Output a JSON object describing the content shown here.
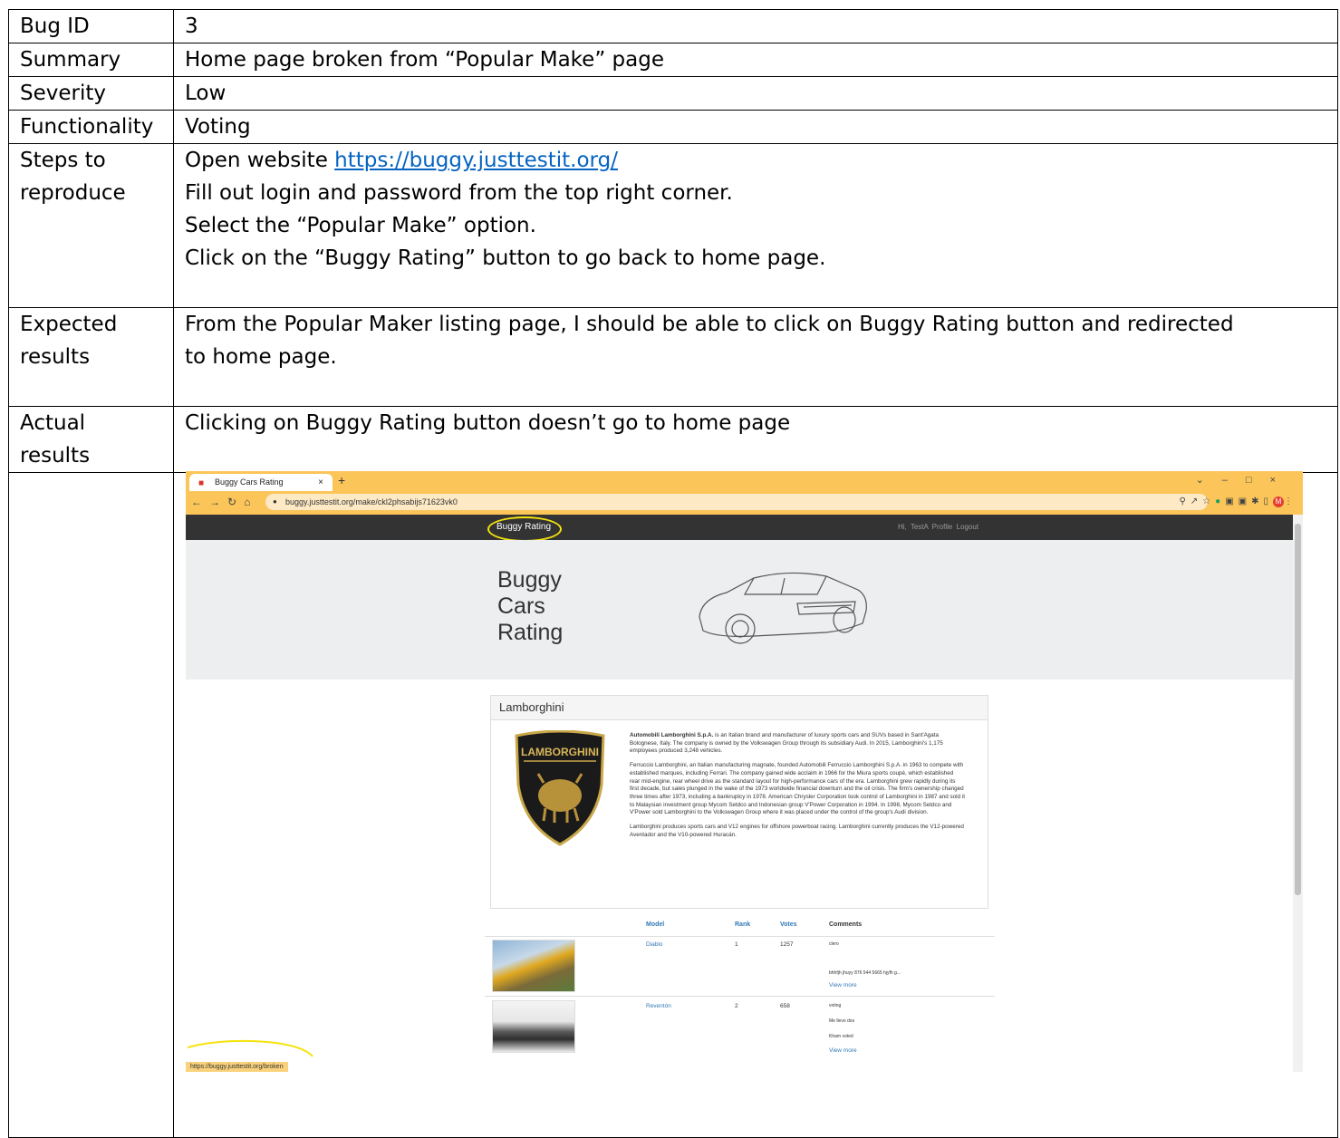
{
  "report": {
    "bug_id_label": "Bug ID",
    "bug_id": "3",
    "summary_label": "Summary",
    "summary": "Home page broken from “Popular Make” page",
    "severity_label": "Severity",
    "severity": "Low",
    "functionality_label": "Functionality",
    "functionality": "Voting",
    "steps_label_1": "Steps to",
    "steps_label_2": "reproduce",
    "steps_open_prefix": "Open website ",
    "steps_url": "https://buggy.justtestit.org/",
    "steps": [
      "Fill out login and password from the top right corner.",
      "Select the “Popular Make” option.",
      "Click on the “Buggy Rating” button to go back to home page."
    ],
    "expected_label_1": "Expected",
    "expected_label_2": "results",
    "expected_line_1": "From the Popular Maker listing page, I should be able to click on Buggy Rating button and redirected",
    "expected_line_2": "to home page.",
    "actual_label_1": "Actual",
    "actual_label_2": "results",
    "actual": "Clicking on Buggy Rating button doesn’t go to home page"
  },
  "browser": {
    "tab_title": "Buggy Cars Rating",
    "tab_close": "×",
    "new_tab": "+",
    "url": "buggy.justtestit.org/make/ckl2phsabijs71623vk0",
    "status_url": "https://buggy.justtestit.org/broken",
    "colors": {
      "chrome": "#fbc55a",
      "highlight": "#f5e30d"
    }
  },
  "site": {
    "brand": "Buggy Rating",
    "user_greeting": "Hi, TestA",
    "profile": "Profile",
    "logout": "Logout",
    "hero_title_1": "Buggy",
    "hero_title_2": "Cars",
    "hero_title_3": "Rating",
    "make_name": "Lamborghini",
    "logo_text": "LAMBORGHINI",
    "desc_lead": "Automobili Lamborghini S.p.A.",
    "desc_p1": " is an Italian brand and manufacturer of luxury sports cars and SUVs based in Sant'Agata Bolognese, Italy. The company is owned by the Volkswagen Group through its subsidiary Audi. In 2015, Lamborghini's 1,175 employees produced 3,248 vehicles.",
    "desc_p2": "Ferruccio Lamborghini, an Italian manufacturing magnate, founded Automobili Ferruccio Lamborghini S.p.A. in 1963 to compete with established marques, including Ferrari. The company gained wide acclaim in 1966 for the Miura sports coupé, which established rear mid-engine, rear wheel drive as the standard layout for high-performance cars of the era. Lamborghini grew rapidly during its first decade, but sales plunged in the wake of the 1973 worldwide financial downturn and the oil crisis. The firm's ownership changed three times after 1973, including a bankruptcy in 1978. American Chrysler Corporation took control of Lamborghini in 1987 and sold it to Malaysian investment group Mycom Setdco and Indonesian group V'Power Corporation in 1994. In 1998, Mycom Setdco and V'Power sold Lamborghini to the Volkswagen Group where it was placed under the control of the group's Audi division.",
    "desc_p3": "Lamborghini produces sports cars and V12 engines for offshore powerboat racing. Lamborghini currently produces the V12-powered Aventador and the V10-powered Huracán.",
    "table_headers": {
      "model": "Model",
      "rank": "Rank",
      "votes": "Votes",
      "comments": "Comments"
    },
    "rows": [
      {
        "model": "Diablo",
        "rank": "1",
        "votes": "1257",
        "comments": [
          "clero",
          "bhhfjh jhuyy 876 544 5665 hjyfh g..."
        ],
        "more": "View more"
      },
      {
        "model": "Reventón",
        "rank": "2",
        "votes": "658",
        "comments": [
          "voting",
          "Me llevo dos",
          "Kham voted"
        ],
        "more": "View more"
      }
    ]
  }
}
